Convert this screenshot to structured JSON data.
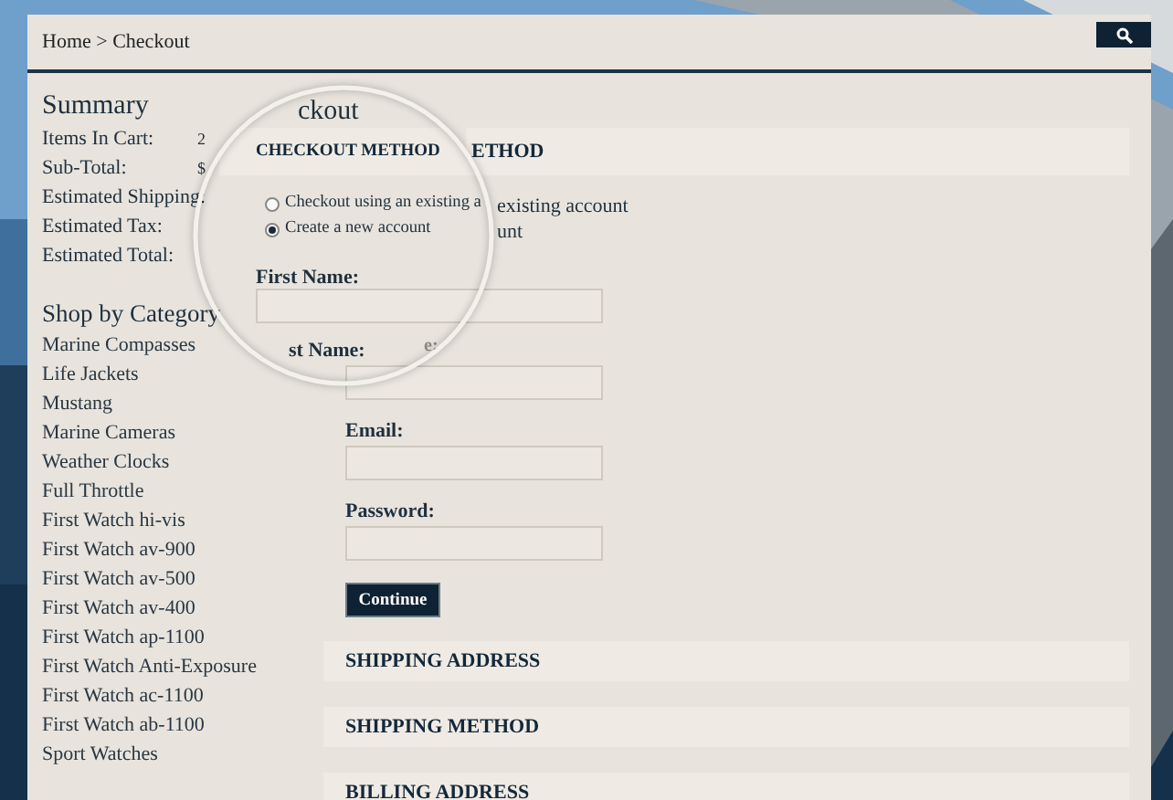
{
  "breadcrumb": "Home > Checkout",
  "summary": {
    "title": "Summary",
    "rows": [
      {
        "label": "Items In Cart:",
        "value": "2"
      },
      {
        "label": "Sub-Total:",
        "value": "$"
      },
      {
        "label": "Estimated Shipping:"
      },
      {
        "label": "Estimated Tax:"
      },
      {
        "label": "Estimated Total:"
      }
    ]
  },
  "categories": {
    "title": "Shop by Category",
    "items": [
      "Marine Compasses",
      "Life Jackets",
      "Mustang",
      "Marine Cameras",
      "Weather Clocks",
      "Full Throttle",
      "First Watch hi-vis",
      "First Watch av-900",
      "First Watch av-500",
      "First Watch av-400",
      "First Watch ap-1100",
      "First Watch Anti-Exposure",
      "First Watch ac-1100",
      "First Watch ab-1100",
      "Sport Watches"
    ]
  },
  "checkout": {
    "method_title": "ETHOD",
    "option_texts": [
      "existing account",
      "unt"
    ],
    "fields": [
      {
        "label": "Email:"
      },
      {
        "label": "Password:"
      }
    ],
    "button": "Continue",
    "sections": [
      "SHIPPING ADDRESS",
      "SHIPPING METHOD",
      "BILLING ADDRESS"
    ]
  },
  "magnifier": {
    "heading": "ckout",
    "section_title": "CHECKOUT METHOD",
    "options": [
      {
        "label": "Checkout using an existing a",
        "selected": false
      },
      {
        "label": "Create a new account",
        "selected": true
      }
    ],
    "field_label": "First Name:",
    "next_label": "st Name:",
    "edge_text": "e:"
  }
}
